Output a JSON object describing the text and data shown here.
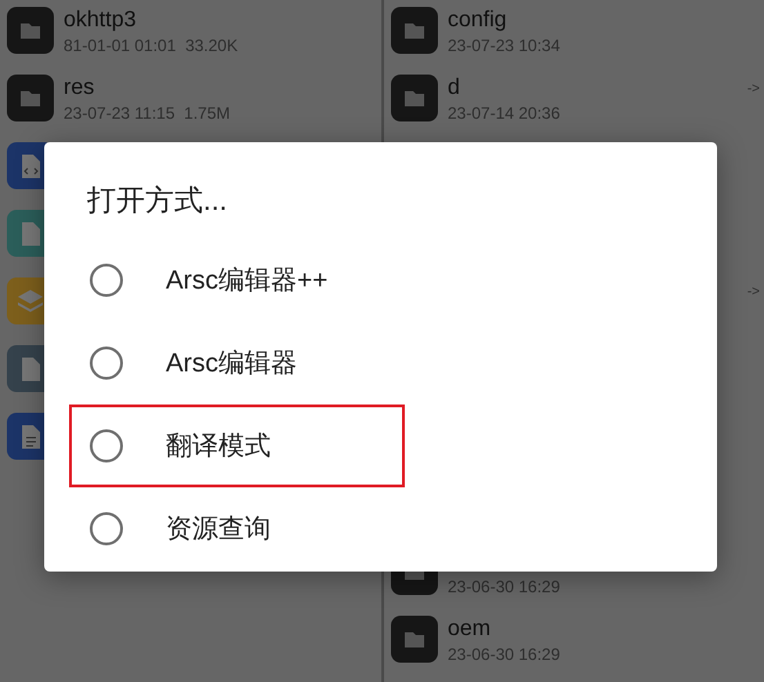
{
  "left_pane": {
    "items": [
      {
        "kind": "folder",
        "name": "okhttp3",
        "meta": "81-01-01 01:01  33.20K"
      },
      {
        "kind": "folder",
        "name": "res",
        "meta": "23-07-23 11:15  1.75M"
      },
      {
        "kind": "code"
      },
      {
        "kind": "binary"
      },
      {
        "kind": "layers"
      },
      {
        "kind": "file"
      },
      {
        "kind": "document"
      }
    ]
  },
  "right_pane": {
    "items": [
      {
        "kind": "folder",
        "name": "config",
        "meta": "23-07-23 10:34"
      },
      {
        "kind": "folder",
        "name": "d",
        "meta": "23-07-14 20:36",
        "link": "->"
      },
      {
        "kind": "hidden"
      },
      {
        "kind": "hidden"
      },
      {
        "kind": "hidden",
        "link": "->"
      },
      {
        "kind": "hidden"
      },
      {
        "kind": "hidden"
      },
      {
        "kind": "hidden"
      },
      {
        "kind": "folder",
        "meta": "23-06-30 16:29"
      },
      {
        "kind": "folder",
        "name": "oem",
        "meta": "23-06-30 16:29"
      }
    ]
  },
  "dialog": {
    "title": "打开方式...",
    "options": [
      {
        "label": "Arsc编辑器++",
        "selected": false,
        "highlighted": false
      },
      {
        "label": "Arsc编辑器",
        "selected": false,
        "highlighted": false
      },
      {
        "label": "翻译模式",
        "selected": false,
        "highlighted": true
      },
      {
        "label": "资源查询",
        "selected": false,
        "highlighted": false
      }
    ]
  }
}
